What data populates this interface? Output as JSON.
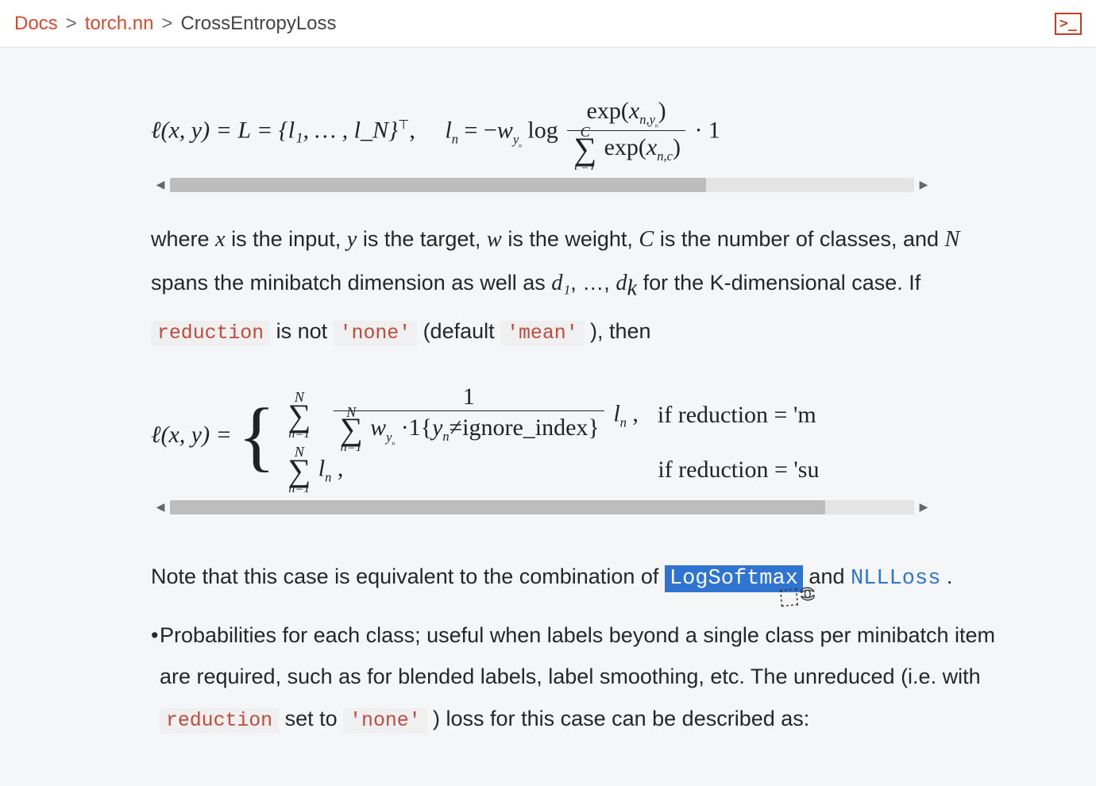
{
  "breadcrumb": {
    "docs": "Docs",
    "module": "torch.nn",
    "page": "CrossEntropyLoss",
    "sep": ">"
  },
  "terminal_icon_glyph": ">_",
  "formula1": {
    "lhs": "ℓ(x, y) = L = {l₁, … , l_N}",
    "transpose": "⊤",
    "comma": ",",
    "ln_label": "l",
    "ln_sub": "n",
    "eq": " = −",
    "w": "w",
    "w_sub": "y",
    "w_sub2": "n",
    "log": " log ",
    "num_exp": "exp(",
    "num_x": "x",
    "num_sub": "n,y",
    "num_sub2": "n",
    "num_close": ")",
    "den_sigma": "∑",
    "den_sup": "C",
    "den_sub": "c=1",
    "den_exp": " exp(",
    "den_x": "x",
    "den_xsub": "n,c",
    "den_close": ")",
    "trail": " · 1"
  },
  "scroll1": {
    "thumb_left_pct": 0,
    "thumb_width_pct": 72
  },
  "para1": {
    "t1": "where ",
    "x": "x",
    "t2": " is the input, ",
    "y": "y",
    "t3": " is the target, ",
    "w": "w",
    "t4": " is the weight, ",
    "C": "C",
    "t5": " is the number of classes, and ",
    "N": "N",
    "t6": " spans the minibatch dimension as well as ",
    "d1": "d₁",
    "t7": ", …, ",
    "dk": "d",
    "dk_sub": "k",
    "t8": " for the K-dimensional case. If ",
    "code1": "reduction",
    "t9": " is not ",
    "code2": "'none'",
    "t10": " (default ",
    "code3": "'mean'",
    "t11": " ), then"
  },
  "formula2": {
    "lhs": "ℓ(x, y) = ",
    "sigma": "∑",
    "sum_sup": "N",
    "sum_sub": "n=1",
    "frac_num": "1",
    "den_sigma": "∑",
    "den_sup": "N",
    "den_sub": "n=1",
    "den_w": " w",
    "den_w_sub": "y",
    "den_w_sub2": "n",
    "den_ind": "·1{",
    "den_y": "y",
    "den_y_sub": "n",
    "den_neq": "≠ignore_index}",
    "ln": "l",
    "ln_sub": "n",
    "comma": " ,",
    "cond1": "if reduction = 'm",
    "row2_sigma": "∑",
    "row2_sup": "N",
    "row2_sub": "n=1",
    "row2_ln": " l",
    "row2_ln_sub": "n",
    "row2_comma": " ,",
    "cond2": "if reduction = 'su"
  },
  "scroll2": {
    "thumb_left_pct": 0,
    "thumb_width_pct": 88
  },
  "note": {
    "t1": "Note that this case is equivalent to the combination of ",
    "sel": "LogSoftmax",
    "t2": " and ",
    "link": "NLLLoss",
    "t3": " ."
  },
  "bullet": {
    "marker": "•",
    "text_a": "Probabilities for each class; useful when labels beyond a single class per minibatch item are required, such as for blended labels, label smoothing, etc. The unreduced (i.e. with ",
    "code1": "reduction",
    "text_b": " set to ",
    "code2": "'none'",
    "text_c": " ) loss for this case can be described as:"
  }
}
